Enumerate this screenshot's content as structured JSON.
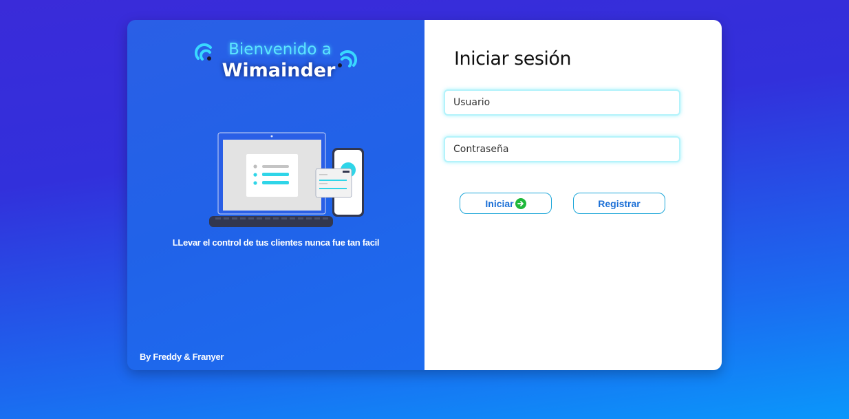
{
  "branding": {
    "welcome_line": "Bienvenido a",
    "app_name": "Wimainder",
    "tagline": "LLevar el control de tus clientes nunca fue tan facil",
    "credit": "By Freddy & Franyer",
    "icons": [
      "wifi-icon",
      "laptop-phone-illustration"
    ]
  },
  "login": {
    "title": "Iniciar sesión",
    "username_placeholder": "Usuario",
    "password_placeholder": "Contraseña",
    "login_label": "Iniciar",
    "login_icon": "arrow-right-circle-icon",
    "register_label": "Registrar"
  },
  "colors": {
    "accent_cyan": "#5ce6ff",
    "button_text": "#1b6fd6",
    "login_icon": "#1fb83b"
  }
}
